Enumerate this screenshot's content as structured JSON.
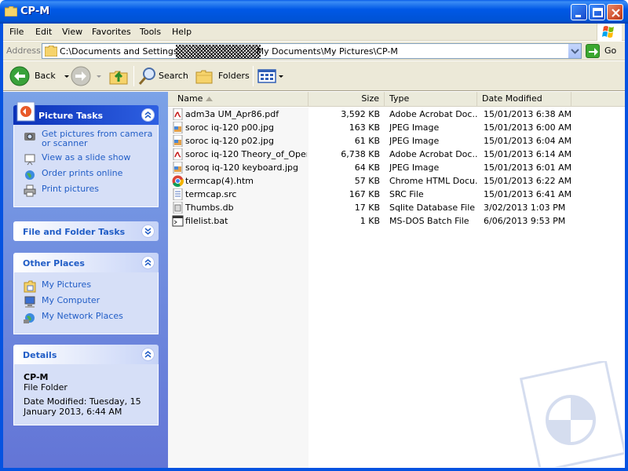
{
  "window": {
    "title": "CP-M",
    "icons": {
      "title": "folder-icon",
      "minimize": "minimize-icon",
      "maximize": "maximize-icon",
      "close": "close-icon"
    }
  },
  "menu": {
    "items": [
      "File",
      "Edit",
      "View",
      "Favorites",
      "Tools",
      "Help"
    ]
  },
  "address": {
    "label": "Address",
    "path_start": "C:\\Documents and Settings",
    "path_end": "My Documents\\My Pictures\\CP-M",
    "go_label": "Go"
  },
  "toolbar": {
    "back_label": "Back",
    "search_label": "Search",
    "folders_label": "Folders"
  },
  "tasks": {
    "picture_tasks": {
      "title": "Picture Tasks",
      "items": [
        {
          "label": "Get pictures from camera or scanner",
          "icon": "camera-icon"
        },
        {
          "label": "View as a slide show",
          "icon": "slideshow-icon"
        },
        {
          "label": "Order prints online",
          "icon": "globe-icon"
        },
        {
          "label": "Print pictures",
          "icon": "printer-icon"
        }
      ]
    },
    "file_folder_tasks": {
      "title": "File and Folder Tasks"
    },
    "other_places": {
      "title": "Other Places",
      "items": [
        {
          "label": "My Pictures",
          "icon": "my-pictures-icon"
        },
        {
          "label": "My Computer",
          "icon": "computer-icon"
        },
        {
          "label": "My Network Places",
          "icon": "network-icon"
        }
      ]
    },
    "details": {
      "title": "Details",
      "name": "CP-M",
      "type": "File Folder",
      "modified": "Date Modified: Tuesday, 15 January 2013, 6:44 AM"
    }
  },
  "files": {
    "headers": {
      "name": "Name",
      "size": "Size",
      "type": "Type",
      "modified": "Date Modified"
    },
    "rows": [
      {
        "name": "adm3a UM_Apr86.pdf",
        "size": "3,592 KB",
        "type": "Adobe Acrobat Doc...",
        "modified": "15/01/2013 6:38 AM",
        "icon": "pdf"
      },
      {
        "name": "soroc iq-120 p00.jpg",
        "size": "163 KB",
        "type": "JPEG Image",
        "modified": "15/01/2013 6:00 AM",
        "icon": "jpg"
      },
      {
        "name": "soroc iq-120 p02.jpg",
        "size": "61 KB",
        "type": "JPEG Image",
        "modified": "15/01/2013 6:04 AM",
        "icon": "jpg"
      },
      {
        "name": "soroc iq-120 Theory_of_Oper...",
        "size": "6,738 KB",
        "type": "Adobe Acrobat Doc...",
        "modified": "15/01/2013 6:14 AM",
        "icon": "pdf"
      },
      {
        "name": "soroq iq-120 keyboard.jpg",
        "size": "64 KB",
        "type": "JPEG Image",
        "modified": "15/01/2013 6:01 AM",
        "icon": "jpg"
      },
      {
        "name": "termcap(4).htm",
        "size": "57 KB",
        "type": "Chrome HTML Docu...",
        "modified": "15/01/2013 6:22 AM",
        "icon": "chrome"
      },
      {
        "name": "termcap.src",
        "size": "167 KB",
        "type": "SRC File",
        "modified": "15/01/2013 6:41 AM",
        "icon": "src"
      },
      {
        "name": "Thumbs.db",
        "size": "17 KB",
        "type": "Sqlite Database File",
        "modified": "3/02/2013 1:03 PM",
        "icon": "db"
      },
      {
        "name": "filelist.bat",
        "size": "1 KB",
        "type": "MS-DOS Batch File",
        "modified": "6/06/2013 9:53 PM",
        "icon": "bat"
      }
    ]
  }
}
